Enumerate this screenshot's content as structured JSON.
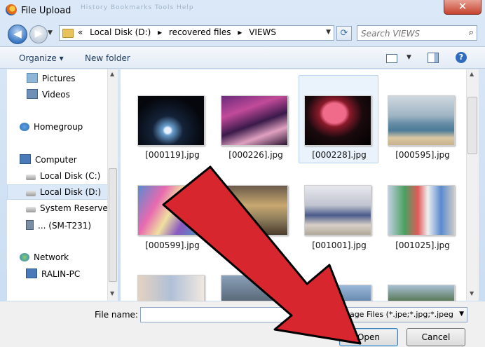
{
  "window": {
    "title": "File Upload",
    "ghost_menu": "History   Bookmarks   Tools   Help",
    "close_glyph": "✕"
  },
  "nav": {
    "back_glyph": "◀",
    "forward_glyph": "▶",
    "breadcrumbs": [
      "«",
      "Local Disk (D:)",
      "▸",
      "recovered files",
      "▸",
      "VIEWS"
    ],
    "search_placeholder": "Search VIEWS"
  },
  "toolbar": {
    "organize": "Organize ▾",
    "new_folder": "New folder",
    "help": "?"
  },
  "sidebar": {
    "items": [
      {
        "label": "Pictures",
        "icon": "pictures-icon"
      },
      {
        "label": "Videos",
        "icon": "videos-icon"
      },
      {
        "label": "Homegroup",
        "icon": "homegroup-icon"
      },
      {
        "label": "Computer",
        "icon": "computer-icon"
      },
      {
        "label": "Local Disk (C:)",
        "icon": "drive-icon"
      },
      {
        "label": "Local Disk (D:)",
        "icon": "drive-icon"
      },
      {
        "label": "System Reserved",
        "icon": "drive-icon"
      },
      {
        "label": "... (SM-T231)",
        "icon": "device-icon"
      },
      {
        "label": "Network",
        "icon": "network-icon"
      },
      {
        "label": "RALIN-PC",
        "icon": "pc-icon"
      }
    ]
  },
  "files": [
    {
      "name": "[000119].jpg"
    },
    {
      "name": "[000226].jpg"
    },
    {
      "name": "[000228].jpg"
    },
    {
      "name": "[000595].jpg"
    },
    {
      "name": "[000599].jpg"
    },
    {
      "name": ""
    },
    {
      "name": "[001001].jpg"
    },
    {
      "name": "[001025].jpg"
    }
  ],
  "bottom": {
    "file_name_label": "File name:",
    "file_name_value": "",
    "filter": "Image Files (*.jpe;*.jpg;*.jpeg",
    "open": "Open",
    "cancel": "Cancel"
  },
  "colors": {
    "arrow": "#d8262e",
    "arrow_outline": "#000000"
  }
}
